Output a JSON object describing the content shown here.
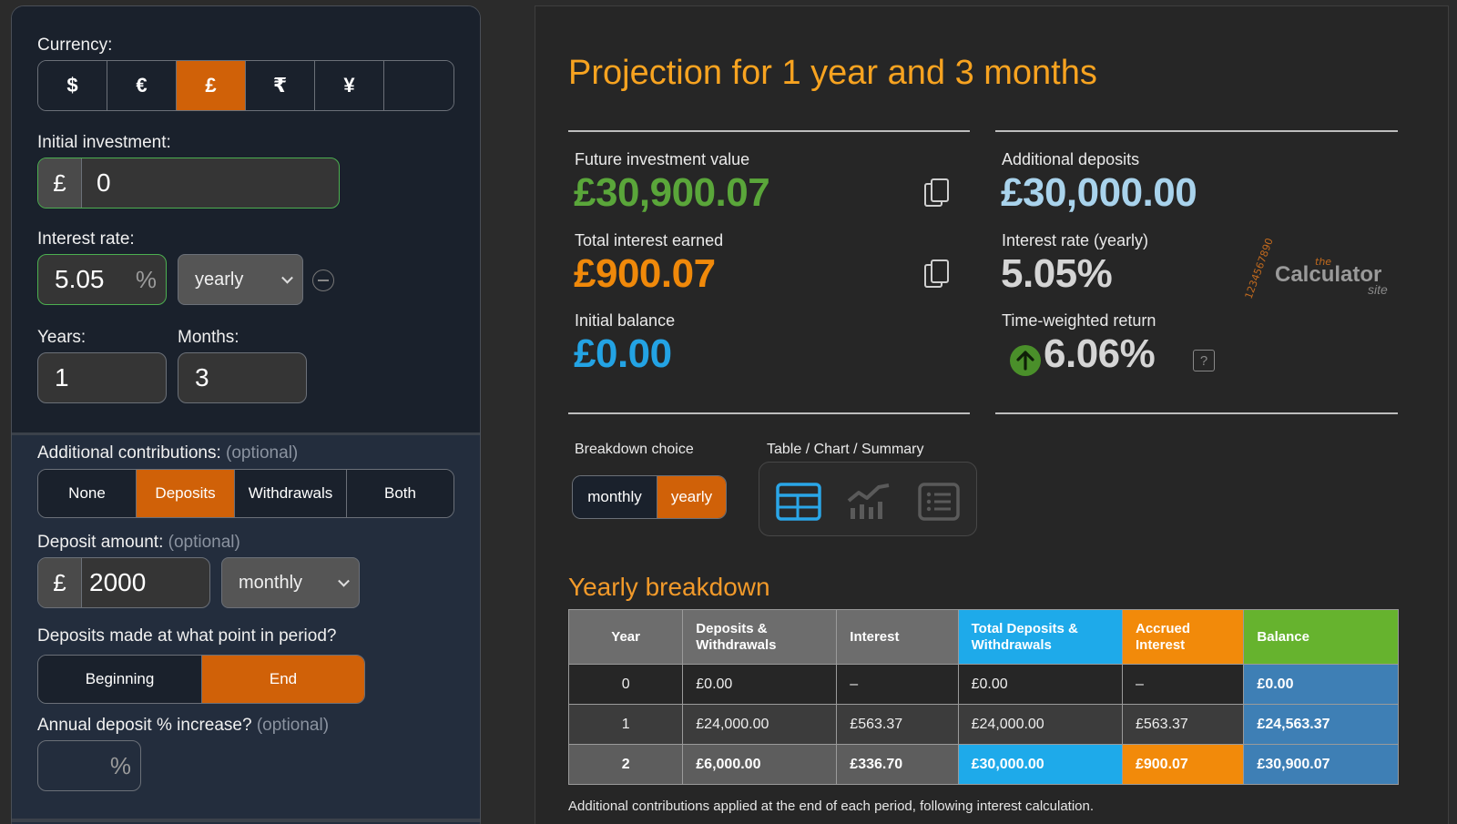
{
  "left": {
    "currency_label": "Currency:",
    "currencies": [
      "$",
      "€",
      "£",
      "₹",
      "¥",
      ""
    ],
    "selected_currency": "£",
    "initial_label": "Initial investment:",
    "initial_prefix": "£",
    "initial_value": "0",
    "rate_label": "Interest rate:",
    "rate_value": "5.05",
    "rate_suffix": "%",
    "rate_period": "yearly",
    "years_label": "Years:",
    "years_value": "1",
    "months_label": "Months:",
    "months_value": "3",
    "contrib_label": "Additional contributions:",
    "contrib_optional": "(optional)",
    "contrib_options": [
      "None",
      "Deposits",
      "Withdrawals",
      "Both"
    ],
    "contrib_selected": "Deposits",
    "deposit_label": "Deposit amount:",
    "deposit_optional": "(optional)",
    "deposit_prefix": "£",
    "deposit_value": "2000",
    "deposit_period": "monthly",
    "timing_label": "Deposits made at what point in period?",
    "timing_options": [
      "Beginning",
      "End"
    ],
    "timing_selected": "End",
    "increase_label": "Annual deposit % increase?",
    "increase_optional": "(optional)",
    "increase_suffix": "%"
  },
  "right": {
    "title": "Projection for 1 year and 3 months",
    "future_label": "Future investment value",
    "future_value": "£30,900.07",
    "interest_label": "Total interest earned",
    "interest_value": "£900.07",
    "initial_label": "Initial balance",
    "initial_value": "£0.00",
    "deposits_label": "Additional deposits",
    "deposits_value": "£30,000.00",
    "rate_label": "Interest rate (yearly)",
    "rate_value": "5.05%",
    "twr_label": "Time-weighted return",
    "twr_value": "6.06%",
    "help_glyph": "?",
    "logo_the": "the",
    "logo_main": "Calculator",
    "logo_site": "site",
    "logo_digits": "1234567890",
    "breakdown_label": "Breakdown choice",
    "breakdown_options": [
      "monthly",
      "yearly"
    ],
    "breakdown_selected": "yearly",
    "view_label": "Table / Chart / Summary",
    "view_icons": [
      "table-icon",
      "chart-icon",
      "summary-list-icon"
    ],
    "yearly_title": "Yearly breakdown",
    "table": {
      "headers": [
        "Year",
        "Deposits & Withdrawals",
        "Interest",
        "Total Deposits & Withdrawals",
        "Accrued Interest",
        "Balance"
      ],
      "rows": [
        [
          "0",
          "£0.00",
          "–",
          "£0.00",
          "–",
          "£0.00"
        ],
        [
          "1",
          "£24,000.00",
          "£563.37",
          "£24,000.00",
          "£563.37",
          "£24,563.37"
        ],
        [
          "2",
          "£6,000.00",
          "£336.70",
          "£30,000.00",
          "£900.07",
          "£30,900.07"
        ]
      ]
    },
    "footnote": "Additional contributions applied at the end of each period, following interest calculation."
  },
  "colors": {
    "accent_orange": "#d06108",
    "title_orange": "#f7a320",
    "green": "#5aa63a",
    "blue": "#23a3e4"
  }
}
